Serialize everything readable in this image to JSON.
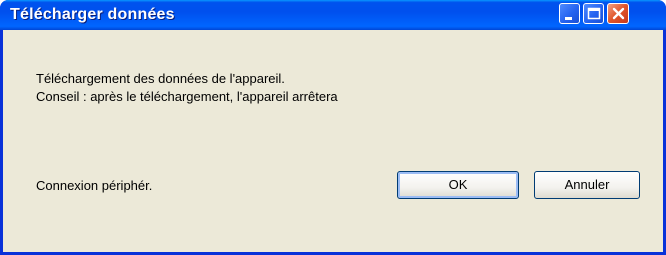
{
  "window": {
    "title": "Télécharger données",
    "controls": {
      "minimize": "minimize-icon",
      "maximize": "maximize-icon",
      "close": "close-icon"
    }
  },
  "dialog": {
    "message_line1": "Téléchargement des données de l'appareil.",
    "message_line2": "Conseil : après le téléchargement, l'appareil arrêtera",
    "status": "Connexion périphér.",
    "ok_label": "OK",
    "cancel_label": "Annuler"
  },
  "colors": {
    "titlebar": "#0054e3",
    "client": "#ece9d8",
    "close_button": "#e0552a"
  }
}
